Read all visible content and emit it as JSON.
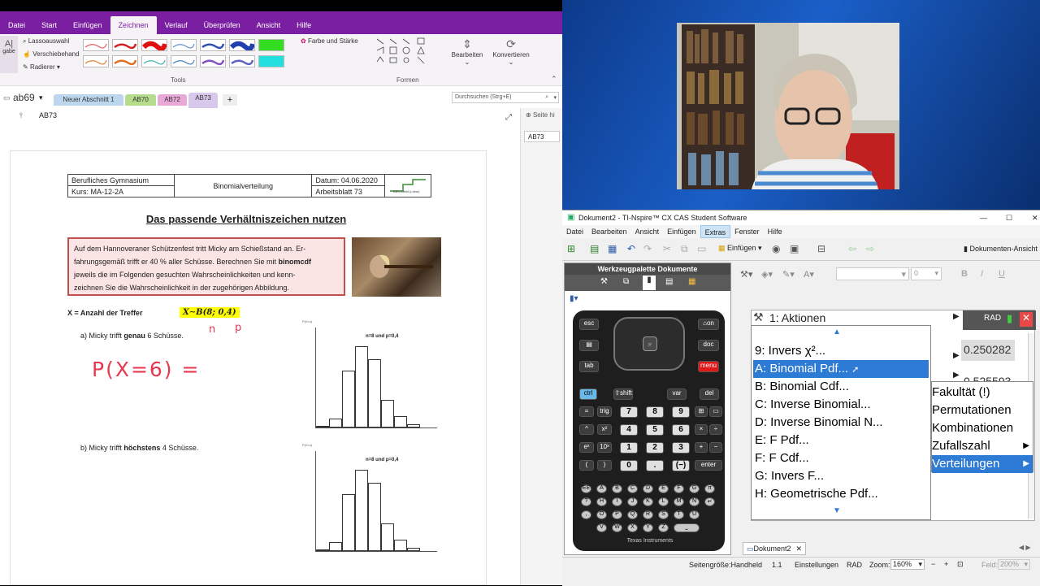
{
  "onenote": {
    "menus": [
      "Datei",
      "Start",
      "Einfügen",
      "Zeichnen",
      "Verlauf",
      "Überprüfen",
      "Ansicht",
      "Hilfe"
    ],
    "active_menu": "Zeichnen",
    "ribbon": {
      "lasso": "Lassoauswahl",
      "move": "Verschiebehand",
      "eraser": "Radierer",
      "left_cut": "gabe",
      "tools_label": "Tools",
      "color_thickness": "Farbe und Stärke",
      "shapes_label": "Formen",
      "edit": "Bearbeiten",
      "convert": "Konvertieren"
    },
    "notebook": "ab69",
    "section_tabs": [
      "Neuer Abschnitt 1",
      "AB70",
      "AB72",
      "AB73"
    ],
    "search_placeholder": "Durchsuchen (Strg+E)",
    "page_title": "AB73",
    "right_pane": {
      "add_page": "Seite hi",
      "page": "AB73"
    },
    "doc": {
      "school": "Berufliches Gymnasium",
      "course": "Kurs: MA-12-2A",
      "topic": "Binomialverteilung",
      "date": "Datum: 04.06.2020",
      "sheet": "Arbeitsblatt 73",
      "logo": "BBS Alfeld (Leine)",
      "heading": "Das passende Verhältniszeichen nutzen",
      "task_1": "Auf dem Hannoveraner Schützenfest tritt Micky am Schießstand an. Er-",
      "task_2": "fahrungsgemäß trifft er 40 % aller Schüsse. Berechnen Sie mit ",
      "task_2b": "binomcdf",
      "task_3": "jeweils die im Folgenden gesuchten Wahrscheinlichkeiten und kenn-",
      "task_4": "zeichnen Sie die Wahrscheinlichkeit in der zugehörigen Abbildung.",
      "x_def": "X = Anzahl der Treffer",
      "dist": "X∼B(8; 0,4)",
      "hand_n": "n",
      "hand_p": "p",
      "a_pre": "a)   Micky trifft ",
      "a_bold": "genau",
      "a_post": " 6 Schüsse.",
      "hand_a": "P(X=6) =",
      "b_pre": "b)   Micky trifft ",
      "b_bold": "höchstens",
      "b_post": " 4 Schüsse.",
      "chart_label": "n=8 und p=0,4",
      "y_axis": "P(X=x)"
    }
  },
  "ti": {
    "title": "Dokument2 - TI-Nspire™ CX CAS Student Software",
    "menus": [
      "Datei",
      "Bearbeiten",
      "Ansicht",
      "Einfügen",
      "Extras",
      "Fenster",
      "Hilfe"
    ],
    "active_menu": "Extras",
    "toolbar": {
      "insert": "Einfügen",
      "doc_view": "Dokumenten-Ansicht",
      "font_size": "0"
    },
    "palette_title": "Werkzeugpalette Dokumente",
    "aktionen": "1: Aktionen",
    "rad": "RAD",
    "values": [
      "0.250282",
      "0.525593"
    ],
    "menu_items": [
      {
        "label": "9: Invers χ²...",
        "selected": false
      },
      {
        "label": "A: Binomial Pdf...",
        "selected": true
      },
      {
        "label": "B: Binomial Cdf...",
        "selected": false
      },
      {
        "label": "C: Inverse Binomial...",
        "selected": false
      },
      {
        "label": "D: Inverse Binomial N...",
        "selected": false
      },
      {
        "label": "E: F Pdf...",
        "selected": false
      },
      {
        "label": "F: F Cdf...",
        "selected": false
      },
      {
        "label": "G: Invers F...",
        "selected": false
      },
      {
        "label": "H: Geometrische Pdf...",
        "selected": false
      }
    ],
    "submenu_items": [
      {
        "label": "Fakultät (!)",
        "selected": false
      },
      {
        "label": "Permutationen",
        "selected": false
      },
      {
        "label": "Kombinationen",
        "selected": false
      },
      {
        "label": "Zufallszahl",
        "selected": false
      },
      {
        "label": "Verteilungen",
        "selected": true
      }
    ],
    "doc_tab": "Dokument2",
    "status": {
      "page_size": "Seitengröße:Handheld",
      "page_no": "1.1",
      "settings": "Einstellungen",
      "mode": "RAD",
      "zoom_label": "Zoom:",
      "zoom": "160%",
      "fit_label": "Feld:",
      "fit": "200%"
    },
    "brand": "Texas Instruments"
  }
}
